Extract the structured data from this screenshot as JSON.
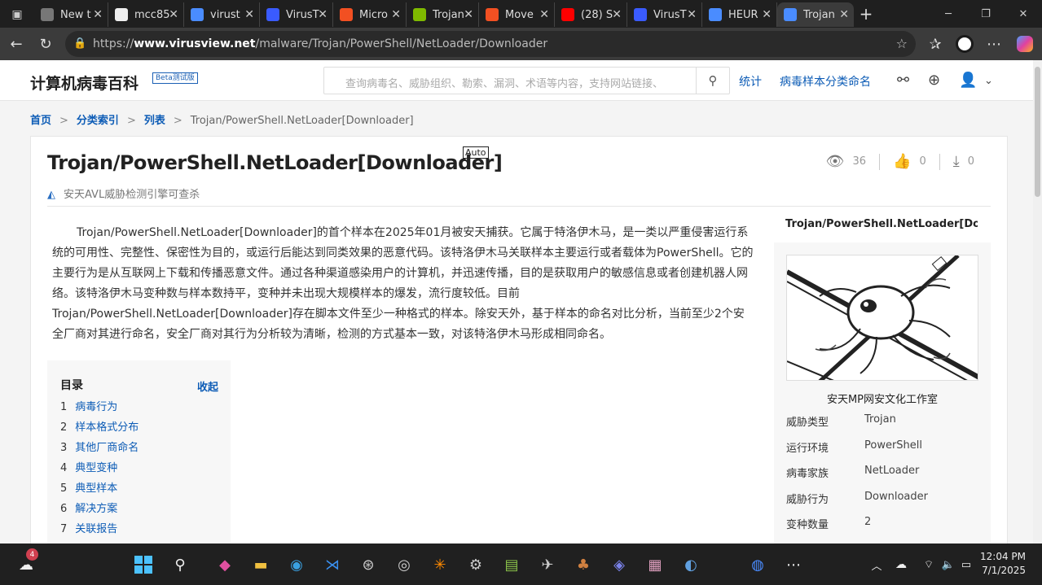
{
  "browser": {
    "tabs": [
      {
        "label": "New t",
        "icon": "tab-icon",
        "color": "#777"
      },
      {
        "label": "mcc85",
        "icon": "github-icon",
        "color": "#eee"
      },
      {
        "label": "virust",
        "icon": "search-icon",
        "color": "#4a8cff"
      },
      {
        "label": "VirusT",
        "icon": "virustotal-icon",
        "color": "#3a5bff"
      },
      {
        "label": "Micro",
        "icon": "microsoft-icon",
        "color": "#f25022"
      },
      {
        "label": "Trojan",
        "icon": "microsoft-icon",
        "color": "#7fba00"
      },
      {
        "label": "Move",
        "icon": "microsoft-icon",
        "color": "#f25022"
      },
      {
        "label": "(28) S",
        "icon": "youtube-icon",
        "color": "#ff0000"
      },
      {
        "label": "VirusT",
        "icon": "virustotal-icon",
        "color": "#3a5bff"
      },
      {
        "label": "HEUR",
        "icon": "search-icon",
        "color": "#4a8cff"
      },
      {
        "label": "Trojan",
        "icon": "virusview-icon",
        "color": "#4a8cff",
        "active": true
      }
    ],
    "url_prefix": "https://",
    "url_host": "www.virusview.net",
    "url_path": "/malware/Trojan/PowerShell/NetLoader/Downloader"
  },
  "site": {
    "logo": "计算机病毒百科",
    "beta": "Beta测试版",
    "search_placeholder": "查询病毒名、威胁组织、勒索、漏洞、术语等内容，支持网站链接、",
    "nav_stats": "统计",
    "nav_naming": "病毒样本分类命名"
  },
  "breadcrumb": {
    "home": "首页",
    "index": "分类索引",
    "list": "列表",
    "current": "Trojan/PowerShell.NetLoader[Downloader]"
  },
  "article": {
    "title": "Trojan/PowerShell.NetLoader[Downloader]",
    "auto_badge": "Auto",
    "avl": "安天AVL威胁检测引擎可查杀",
    "views": "36",
    "likes": "0",
    "downloads": "0",
    "description": "Trojan/PowerShell.NetLoader[Downloader]的首个样本在2025年01月被安天捕获。它属于特洛伊木马，是一类以严重侵害运行系统的可用性、完整性、保密性为目的，或运行后能达到同类效果的恶意代码。该特洛伊木马关联样本主要运行或者载体为PowerShell。它的主要行为是从互联网上下载和传播恶意文件。通过各种渠道感染用户的计算机，并迅速传播，目的是获取用户的敏感信息或者创建机器人网络。该特洛伊木马变种数与样本数持平，变种并未出现大规模样本的爆发，流行度较低。目前Trojan/PowerShell.NetLoader[Downloader]存在脚本文件至少一种格式的样本。除安天外，基于样本的命名对比分析，当前至少2个安全厂商对其进行命名，安全厂商对其行为分析较为清晰，检测的方式基本一致，对该特洛伊木马形成相同命名。"
  },
  "toc": {
    "heading": "目录",
    "collapse": "收起",
    "items": [
      {
        "n": "1",
        "label": "病毒行为"
      },
      {
        "n": "2",
        "label": "样本格式分布"
      },
      {
        "n": "3",
        "label": "其他厂商命名"
      },
      {
        "n": "4",
        "label": "典型变种"
      },
      {
        "n": "5",
        "label": "典型样本"
      },
      {
        "n": "6",
        "label": "解决方案"
      },
      {
        "n": "7",
        "label": "关联报告"
      }
    ]
  },
  "sidebar": {
    "title": "Trojan/PowerShell.NetLoader[Downl...",
    "image_caption": "安天MP网安文化工作室",
    "rows": [
      {
        "k": "威胁类型",
        "v": "Trojan"
      },
      {
        "k": "运行环境",
        "v": "PowerShell"
      },
      {
        "k": "病毒家族",
        "v": "NetLoader"
      },
      {
        "k": "威胁行为",
        "v": "Downloader"
      },
      {
        "k": "变种数量",
        "v": "2"
      }
    ]
  },
  "taskbar": {
    "weather_badge": "4",
    "time": "12:04 PM",
    "date": "7/1/2025"
  }
}
